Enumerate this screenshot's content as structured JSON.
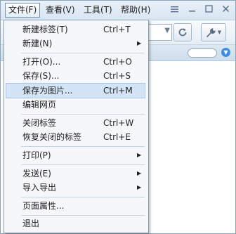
{
  "menubar": {
    "file": "文件(F)",
    "view": "查看(V)",
    "tools": "工具(T)",
    "help": "帮助(H)"
  },
  "window_controls": {
    "menu_icon": "hamburger-icon",
    "minimize": "minimize-icon",
    "maximize": "maximize-icon",
    "close": "close-icon"
  },
  "file_menu": {
    "items": [
      {
        "label": "新建标签(T)",
        "shortcut": "Ctrl+T"
      },
      {
        "label": "新建(N)",
        "shortcut": ""
      },
      {
        "label": "打开(O)...",
        "shortcut": "Ctrl+O"
      },
      {
        "label": "保存(S)...",
        "shortcut": "Ctrl+S"
      },
      {
        "label": "保存为图片...",
        "shortcut": "Ctrl+M"
      },
      {
        "label": "编辑网页",
        "shortcut": ""
      },
      {
        "label": "关闭标签",
        "shortcut": "Ctrl+W"
      },
      {
        "label": "恢复关闭的标签",
        "shortcut": "Ctrl+E"
      },
      {
        "label": "打印(P)",
        "shortcut": ""
      },
      {
        "label": "发送(E)",
        "shortcut": ""
      },
      {
        "label": "导入导出",
        "shortcut": ""
      },
      {
        "label": "页面属性...",
        "shortcut": ""
      },
      {
        "label": "退出",
        "shortcut": ""
      }
    ],
    "highlighted_index": 4
  },
  "colors": {
    "highlight": "#d4e4f7",
    "accent": "#3a8ee6"
  }
}
